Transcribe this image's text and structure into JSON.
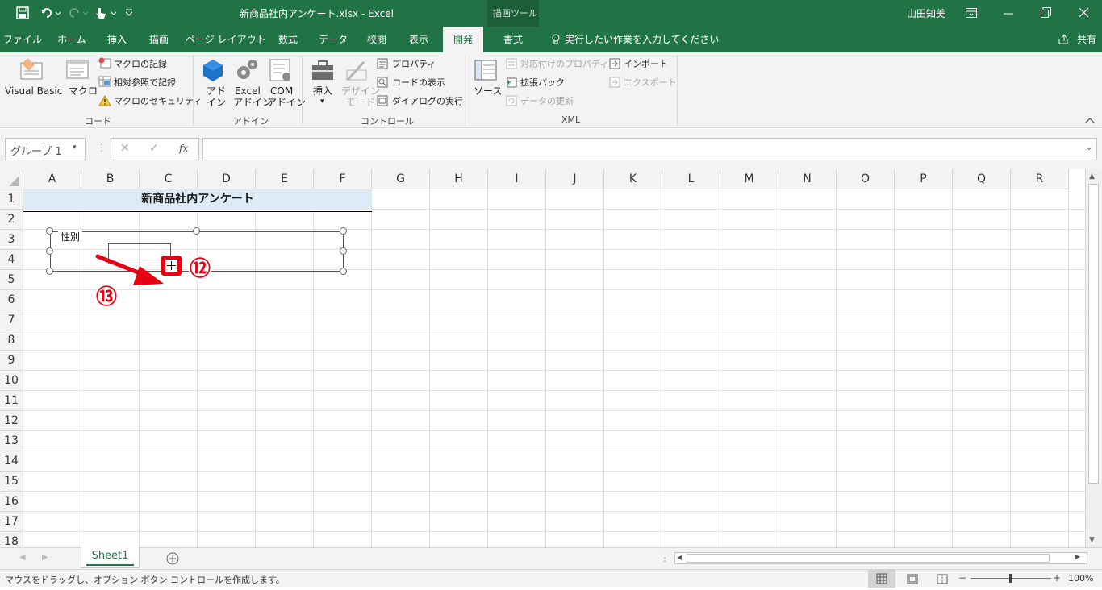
{
  "title": {
    "filename": "新商品社内アンケート.xlsx",
    "separator": "-",
    "app": "Excel",
    "context_tool": "描画ツール",
    "user": "山田知美"
  },
  "tabs": [
    {
      "label": "ファイル"
    },
    {
      "label": "ホーム"
    },
    {
      "label": "挿入"
    },
    {
      "label": "描画"
    },
    {
      "label": "ページ レイアウト"
    },
    {
      "label": "数式"
    },
    {
      "label": "データ"
    },
    {
      "label": "校閲"
    },
    {
      "label": "表示"
    },
    {
      "label": "開発"
    },
    {
      "label": "書式"
    }
  ],
  "tell_me": "実行したい作業を入力してください",
  "share": "共有",
  "ribbon": {
    "code": {
      "label": "コード",
      "vb": "Visual Basic",
      "macro": "マクロ",
      "record": "マクロの記録",
      "relative": "相対参照で記録",
      "security": "マクロのセキュリティ"
    },
    "addins": {
      "label": "アドイン",
      "addin_1": "アド",
      "addin_2": "イン",
      "excel_1": "Excel",
      "excel_2": "アドイン",
      "com_1": "COM",
      "com_2": "アドイン"
    },
    "controls": {
      "label": "コントロール",
      "insert": "挿入",
      "design_1": "デザイン",
      "design_2": "モード",
      "properties": "プロパティ",
      "view_code": "コードの表示",
      "dialog": "ダイアログの実行"
    },
    "xml": {
      "label": "XML",
      "source": "ソース",
      "map_props": "対応付けのプロパティ",
      "expansion": "拡張パック",
      "refresh": "データの更新",
      "import": "インポート",
      "export": "エクスポート"
    }
  },
  "namebox": "グループ 1",
  "fx": "fx",
  "columns": [
    "A",
    "B",
    "C",
    "D",
    "E",
    "F",
    "G",
    "H",
    "I",
    "J",
    "K",
    "L",
    "M",
    "N",
    "O",
    "P",
    "Q",
    "R"
  ],
  "rows": [
    "1",
    "2",
    "3",
    "4",
    "5",
    "6",
    "7",
    "8",
    "9",
    "10",
    "11",
    "12",
    "13",
    "14",
    "15",
    "16",
    "17",
    "18"
  ],
  "cells": {
    "title": "新商品社内アンケート",
    "groupbox_label": "性別"
  },
  "annotations": {
    "step12": "⑫",
    "step13": "⑬"
  },
  "sheet_tab": "Sheet1",
  "status_text": "マウスをドラッグし、オプション ボタン コントロールを作成します。",
  "zoom": "100%",
  "colors": {
    "excel_green": "#217346",
    "annotation_red": "#e60012",
    "title_fill": "#ddebf7"
  }
}
